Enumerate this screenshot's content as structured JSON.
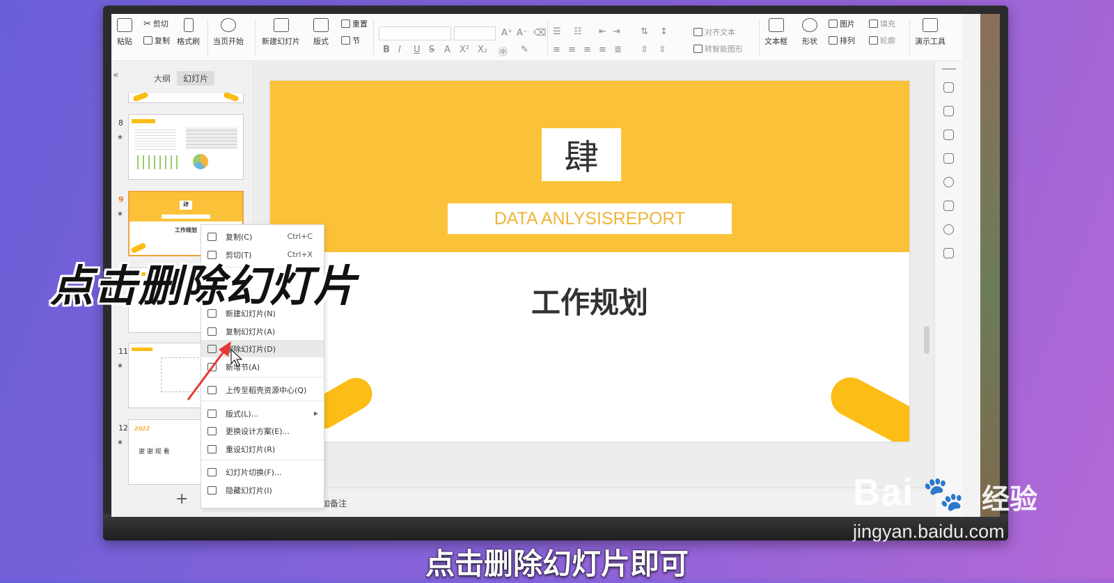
{
  "toolbar": {
    "paste": "粘贴",
    "cut": "剪切",
    "copy": "复制",
    "format_painter": "格式刷",
    "from_current": "当页开始",
    "new_slide": "新建幻灯片",
    "layout": "版式",
    "reset": "重置",
    "section": "节",
    "align_text": "对齐文本",
    "to_smartart": "转智能图形",
    "textbox": "文本框",
    "shape": "形状",
    "picture": "图片",
    "fill": "填充",
    "arrange": "排列",
    "outline": "轮廓",
    "present_tools": "演示工具",
    "format_glyphs": [
      "B",
      "I",
      "U",
      "S",
      "A",
      "X²",
      "X₂"
    ]
  },
  "side_panel": {
    "collapse_glyph": "«",
    "tabs": [
      "大纲",
      "幻灯片"
    ],
    "active_tab": "幻灯片",
    "slide_numbers": [
      "8",
      "9",
      "11",
      "12"
    ],
    "add_glyph": "+",
    "thumb12_year": "2022",
    "thumb12_text": "谢 谢 观 看"
  },
  "slide": {
    "big_char": "肆",
    "subtitle": "DATA ANLYSISREPORT",
    "title": "工作规划",
    "thumb_title": "工作规划"
  },
  "notes": {
    "placeholder": "加备注"
  },
  "context_menu": {
    "items": [
      {
        "label": "复制(C)",
        "shortcut": "Ctrl+C"
      },
      {
        "label": "剪切(T)",
        "shortcut": "Ctrl+X"
      },
      {
        "label": "新建幻灯片(N)"
      },
      {
        "label": "复制幻灯片(A)"
      },
      {
        "label": "删除幻灯片(D)"
      },
      {
        "label": "新增节(A)"
      },
      {
        "label": "上传至稻壳资源中心(Q)"
      },
      {
        "label": "版式(L)..."
      },
      {
        "label": "更换设计方案(E)..."
      },
      {
        "label": "重设幻灯片(R)"
      },
      {
        "label": "幻灯片切换(F)..."
      },
      {
        "label": "隐藏幻灯片(I)"
      }
    ],
    "hovered": "删除幻灯片(D)"
  },
  "overlay": {
    "title": "点击删除幻灯片",
    "caption": "点击删除幻灯片即可"
  },
  "watermark": {
    "logo": "Bai",
    "logo_suffix": "经验",
    "url": "jingyan.baidu.com"
  },
  "colors": {
    "slide_yellow": "#fbc239",
    "deco_yellow": "#fbbd16",
    "selection_orange": "#f0a23b",
    "annotation_red": "#e53935"
  }
}
